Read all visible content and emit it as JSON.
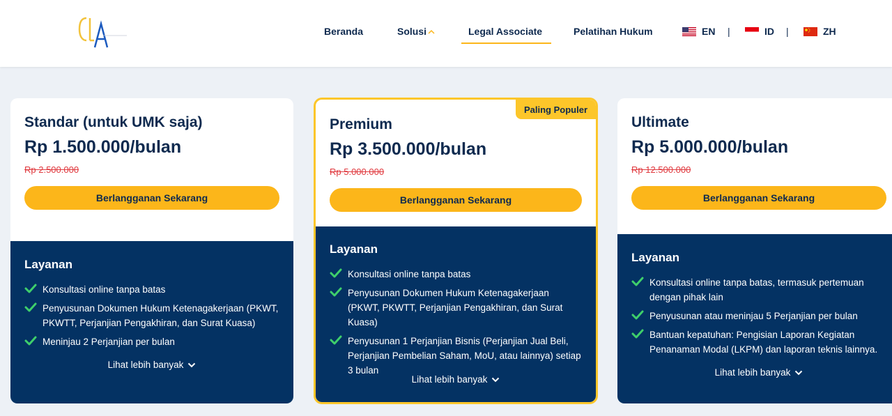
{
  "header": {
    "logo_text": "CLA",
    "nav": [
      {
        "label": "Beranda"
      },
      {
        "label": "Solusi"
      },
      {
        "label": "Legal Associate"
      },
      {
        "label": "Pelatihan Hukum"
      }
    ],
    "languages": [
      {
        "code": "EN",
        "flag": "us-flag-icon"
      },
      {
        "code": "ID",
        "flag": "id-flag-icon"
      },
      {
        "code": "ZH",
        "flag": "cn-flag-icon"
      }
    ],
    "separator": "|"
  },
  "plans": [
    {
      "title": "Standar (untuk UMK saja)",
      "price": "Rp 1.500.000/bulan",
      "old_price": "Rp 2.500.000",
      "cta": "Berlangganan Sekarang",
      "services_title": "Layanan",
      "features": [
        "Konsultasi online tanpa batas",
        "Penyusunan Dokumen Hukum Ketenagakerjaan (PKWT, PKWTT, Perjanjian Pengakhiran, dan Surat Kuasa)",
        "Meninjau 2 Perjanjian per bulan"
      ],
      "more": "Lihat lebih banyak"
    },
    {
      "badge": "Paling Populer",
      "title": "Premium",
      "price": "Rp 3.500.000/bulan",
      "old_price": "Rp 5.000.000",
      "cta": "Berlangganan Sekarang",
      "services_title": "Layanan",
      "features": [
        "Konsultasi online tanpa batas",
        "Penyusunan Dokumen Hukum Ketenagakerjaan (PKWT, PKWTT, Perjanjian Pengakhiran, dan Surat Kuasa)",
        "Penyusunan 1 Perjanjian Bisnis (Perjanjian Jual Beli, Perjanjian Pembelian Saham, MoU, atau lainnya) setiap 3 bulan"
      ],
      "more": "Lihat lebih banyak"
    },
    {
      "title": "Ultimate",
      "price": "Rp 5.000.000/bulan",
      "old_price": "Rp 12.500.000",
      "cta": "Berlangganan Sekarang",
      "services_title": "Layanan",
      "features": [
        "Konsultasi online tanpa batas, termasuk pertemuan dengan pihak lain",
        "Penyusunan atau meninjau 5 Perjanjian per bulan",
        "Bantuan kepatuhan: Pengisian Laporan Kegiatan Penanaman Modal (LKPM) dan laporan teknis lainnya."
      ],
      "more": "Lihat lebih banyak"
    }
  ],
  "colors": {
    "brand_navy": "#043263",
    "accent_yellow": "#fcb61a",
    "strike_red": "#e0393e",
    "check_green": "#3fcf6b"
  }
}
